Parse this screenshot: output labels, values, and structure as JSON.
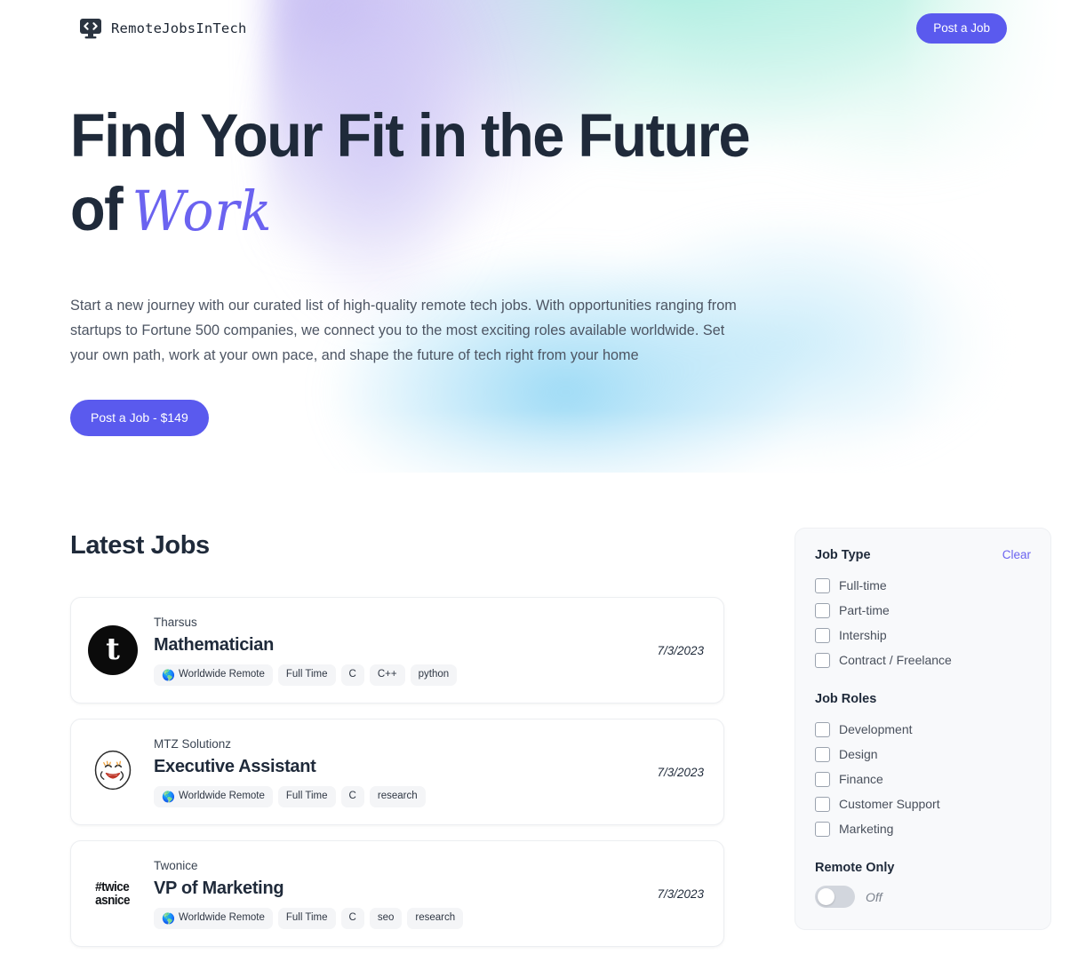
{
  "header": {
    "brand_name": "RemoteJobsInTech",
    "brand_icon": "code-monitor-icon",
    "post_job_label": "Post a Job"
  },
  "hero": {
    "title_line1": "Find Your Fit in the Future",
    "title_line2_prefix": "of",
    "title_script_word": "Work",
    "description": "Start a new journey with our curated list of high-quality remote tech jobs. With opportunities ranging from startups to Fortune 500 companies, we connect you to the most exciting roles available worldwide. Set your own path, work at your own pace, and shape the future of tech right from your home",
    "cta_label": "Post a Job - $149"
  },
  "jobs_section": {
    "heading": "Latest Jobs",
    "items": [
      {
        "company": "Tharsus",
        "title": "Mathematician",
        "date": "7/3/2023",
        "logo_kind": "tharsus",
        "logo_text": "t",
        "tags": [
          "Worldwide Remote",
          "Full Time",
          "C",
          "C++",
          "python"
        ],
        "globe_icon": "🌎"
      },
      {
        "company": "MTZ Solutionz",
        "title": "Executive Assistant",
        "date": "7/3/2023",
        "logo_kind": "smiley",
        "logo_text": "",
        "tags": [
          "Worldwide Remote",
          "Full Time",
          "C",
          "research"
        ],
        "globe_icon": "🌎"
      },
      {
        "company": "Twonice",
        "title": "VP of Marketing",
        "date": "7/3/2023",
        "logo_kind": "twice",
        "logo_line1": "#twice",
        "logo_line2": "asnice",
        "tags": [
          "Worldwide Remote",
          "Full Time",
          "C",
          "seo",
          "research"
        ],
        "globe_icon": "🌎"
      }
    ]
  },
  "filters": {
    "job_type": {
      "title": "Job Type",
      "clear_label": "Clear",
      "options": [
        "Full-time",
        "Part-time",
        "Intership",
        "Contract / Freelance"
      ]
    },
    "job_roles": {
      "title": "Job Roles",
      "options": [
        "Development",
        "Design",
        "Finance",
        "Customer Support",
        "Marketing"
      ]
    },
    "remote_only": {
      "title": "Remote Only",
      "state_label": "Off",
      "state_on": false
    }
  },
  "colors": {
    "accent": "#5a5aee",
    "link": "#6b63f0",
    "heading": "#1f2a3a",
    "body": "#4d5563",
    "panel_bg": "#f8f9fb",
    "tag_bg": "#f4f5f7"
  }
}
